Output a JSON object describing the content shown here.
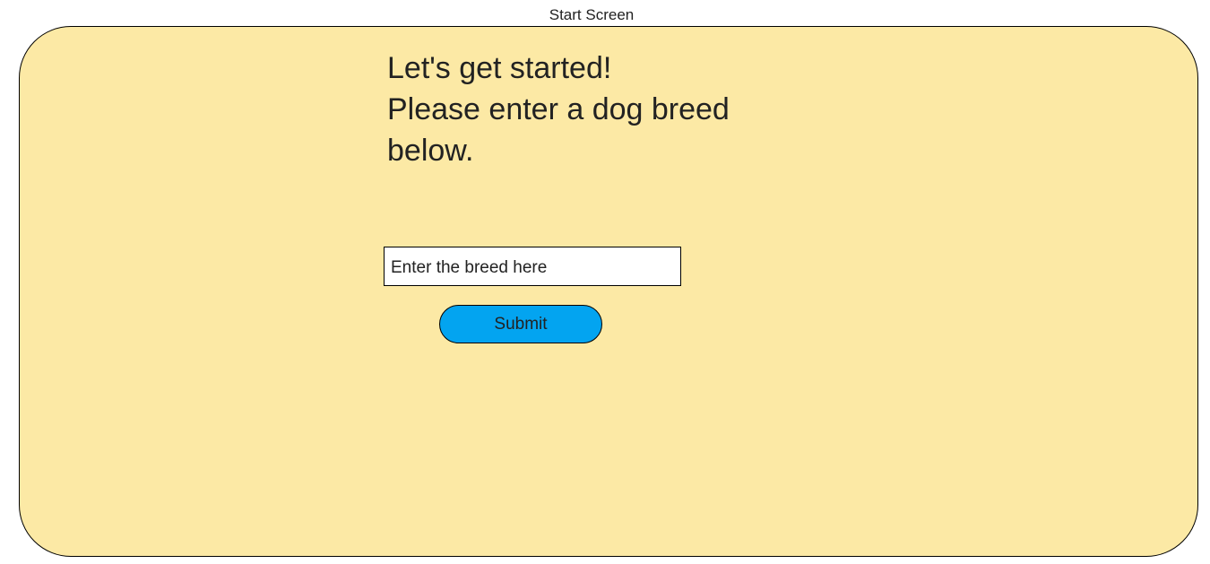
{
  "screen": {
    "title": "Start Screen",
    "background_color": "#fce9a5"
  },
  "heading": {
    "lines": [
      "Let's get started!",
      "Please enter a dog breed",
      "below."
    ]
  },
  "breed_input": {
    "value": "",
    "placeholder": "Enter the breed here"
  },
  "submit_button": {
    "label": "Submit",
    "color": "#03a4f0"
  }
}
